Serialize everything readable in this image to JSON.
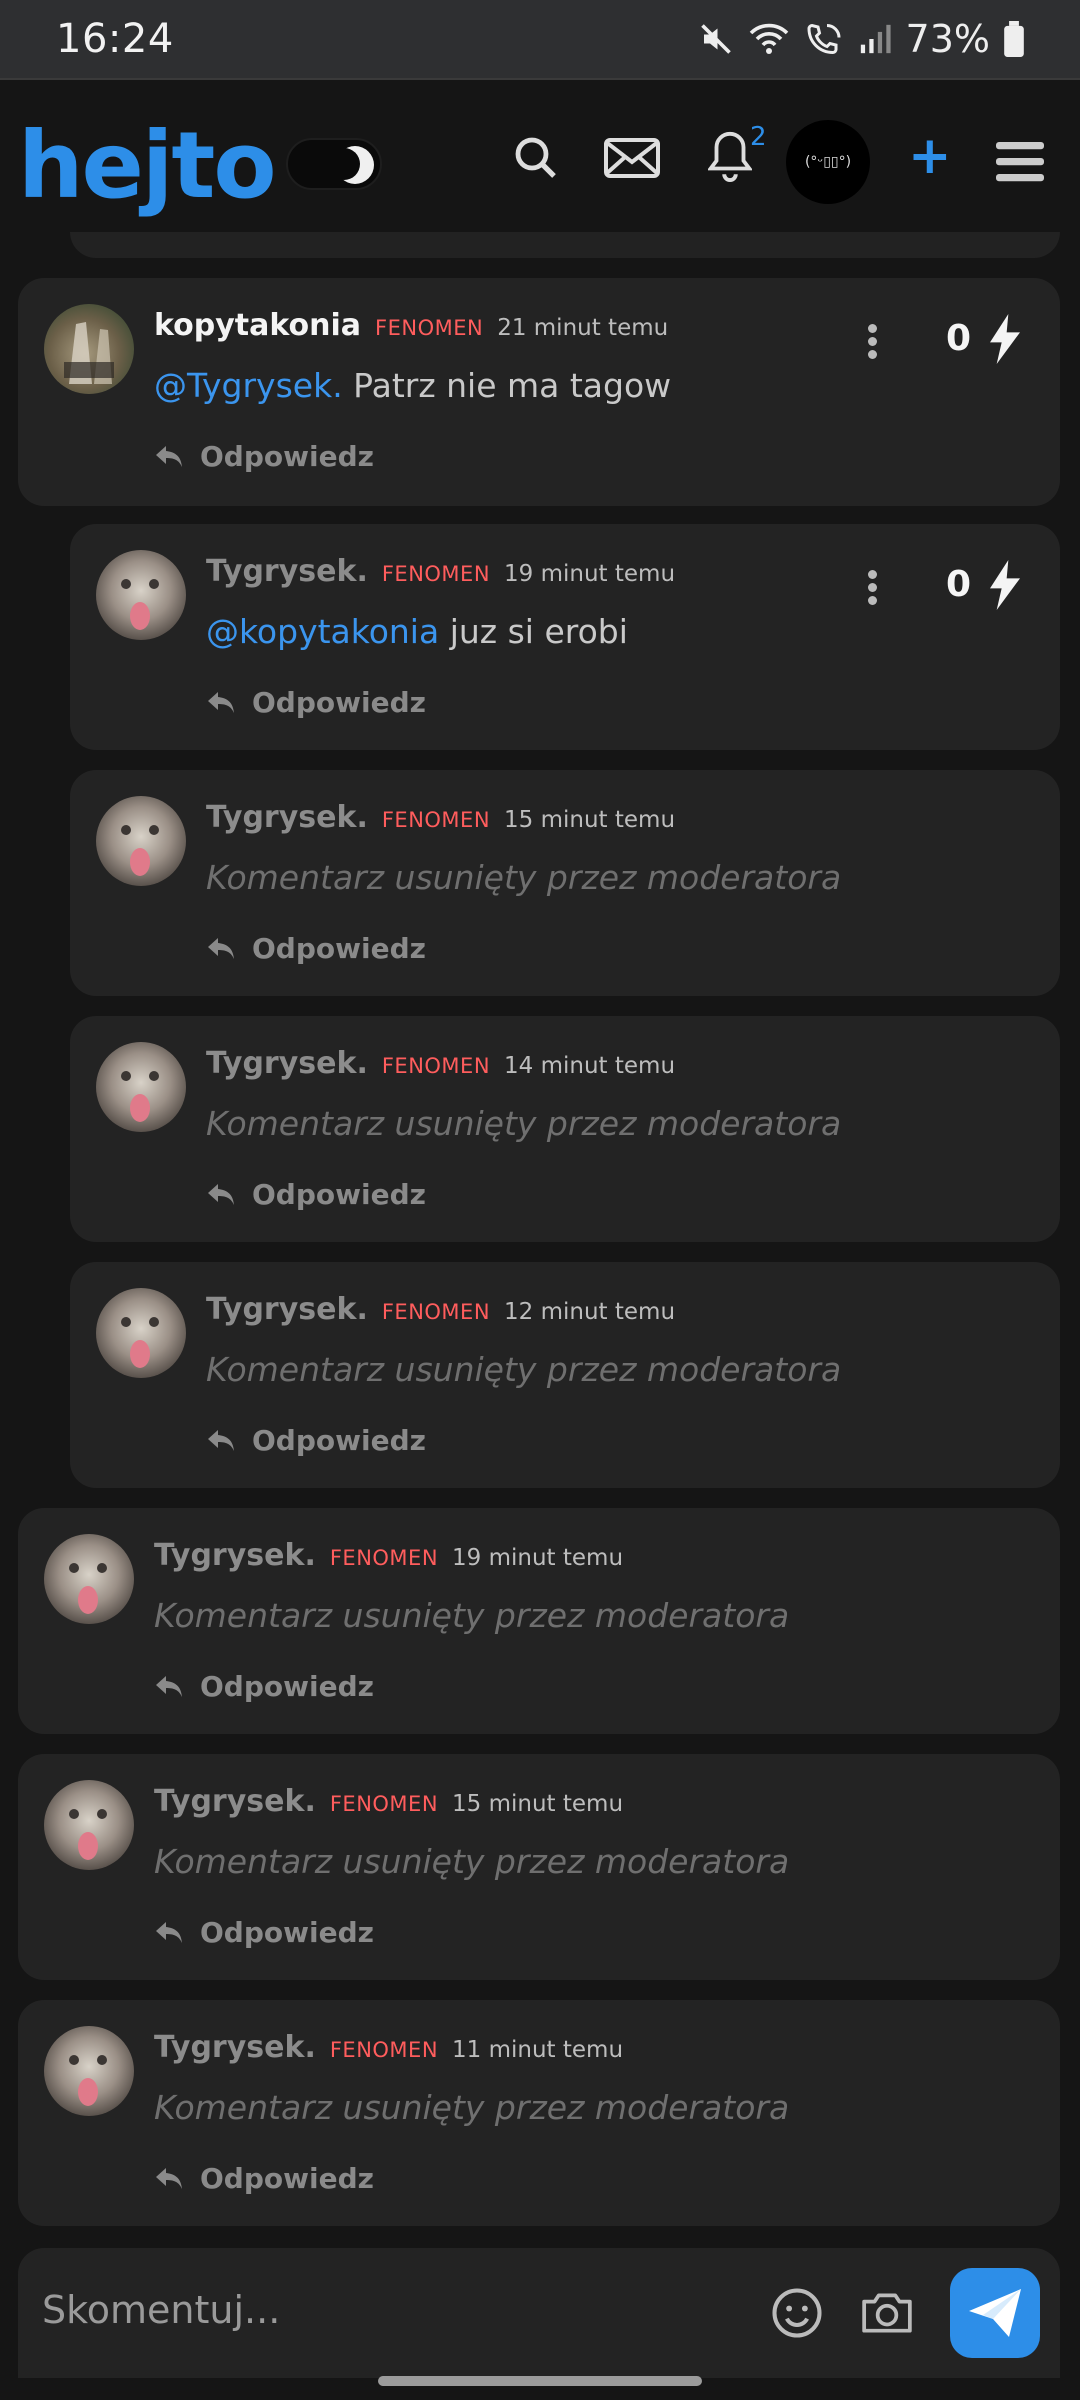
{
  "status_bar": {
    "time": "16:24",
    "battery": "73%"
  },
  "header": {
    "logo": "hejto",
    "notifications_count": "2",
    "avatar_text": "(°ᵕ▯▯°)"
  },
  "comments": [
    {
      "user": "kopytakonia",
      "rank": "FENOMEN",
      "time": "21 minut temu",
      "mention": "@Tygrysek.",
      "text": " Patrz nie ma tagow",
      "reply": "Odpowiedz",
      "score": "0"
    },
    {
      "user": "Tygrysek.",
      "rank": "FENOMEN",
      "time": "19 minut temu",
      "mention": "@kopytakonia",
      "text": " juz si erobi",
      "reply": "Odpowiedz",
      "score": "0"
    },
    {
      "user": "Tygrysek.",
      "rank": "FENOMEN",
      "time": "15 minut temu",
      "text": "Komentarz usunięty przez moderatora",
      "reply": "Odpowiedz"
    },
    {
      "user": "Tygrysek.",
      "rank": "FENOMEN",
      "time": "14 minut temu",
      "text": "Komentarz usunięty przez moderatora",
      "reply": "Odpowiedz"
    },
    {
      "user": "Tygrysek.",
      "rank": "FENOMEN",
      "time": "12 minut temu",
      "text": "Komentarz usunięty przez moderatora",
      "reply": "Odpowiedz"
    },
    {
      "user": "Tygrysek.",
      "rank": "FENOMEN",
      "time": "19 minut temu",
      "text": "Komentarz usunięty przez moderatora",
      "reply": "Odpowiedz"
    },
    {
      "user": "Tygrysek.",
      "rank": "FENOMEN",
      "time": "15 minut temu",
      "text": "Komentarz usunięty przez moderatora",
      "reply": "Odpowiedz"
    },
    {
      "user": "Tygrysek.",
      "rank": "FENOMEN",
      "time": "11 minut temu",
      "text": "Komentarz usunięty przez moderatora",
      "reply": "Odpowiedz"
    }
  ],
  "composer": {
    "placeholder": "Skomentuj..."
  },
  "colors": {
    "accent": "#2d8ee8",
    "rank": "#ff5d5d",
    "card": "#232323",
    "background": "#151515"
  }
}
